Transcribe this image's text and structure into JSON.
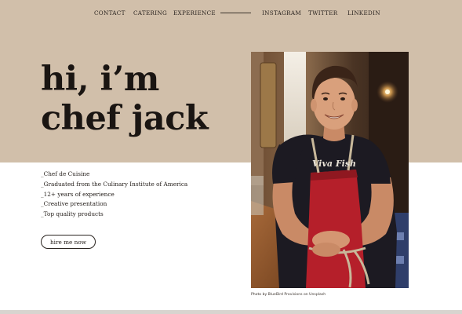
{
  "colors": {
    "hero_background": "#d1bfaa",
    "page_background": "#ffffff",
    "text": "#1c1714",
    "apron_red": "#b51f2a"
  },
  "nav": {
    "left_links": [
      "CONTACT",
      "CATERING",
      "EXPERIENCE"
    ],
    "right_links": [
      "INSTAGRAM",
      "TWITTER",
      "LINKEDIN"
    ]
  },
  "hero": {
    "headline_line1": "hi, i’m",
    "headline_line2": "chef jack"
  },
  "bio": {
    "items": [
      "_Chef de Cuisine",
      "_Graduated from the Culinary Institute of America",
      "_12+ years of experience",
      "_Creative presentation",
      "_Top quality products"
    ]
  },
  "cta": {
    "label": "hire me now"
  },
  "photo": {
    "description_icon": "chef-portrait-photo",
    "shirt_text": "Viva Fish",
    "credit": "Photo by BlueBird Provisions on Unsplash"
  }
}
